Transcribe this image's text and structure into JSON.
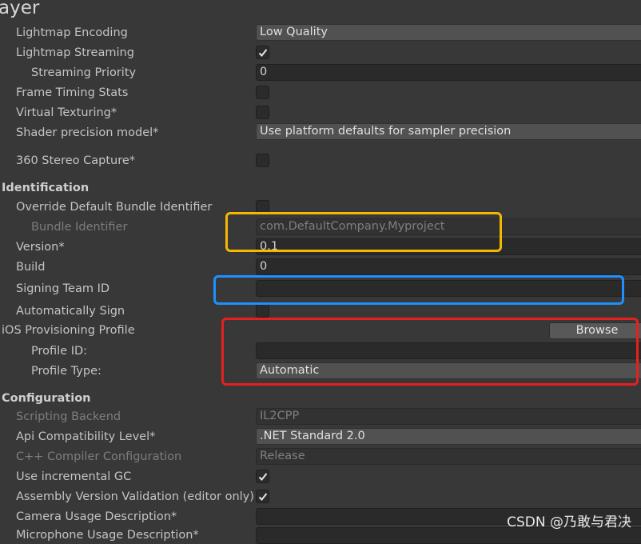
{
  "header": {
    "title": "ayer"
  },
  "rows": {
    "lightmap_encoding": {
      "label": "Lightmap Encoding",
      "value": "Low Quality"
    },
    "lightmap_streaming": {
      "label": "Lightmap Streaming",
      "checked": true
    },
    "streaming_priority": {
      "label": "Streaming Priority",
      "value": "0"
    },
    "frame_timing": {
      "label": "Frame Timing Stats",
      "checked": false
    },
    "virtual_texturing": {
      "label": "Virtual Texturing*",
      "checked": false
    },
    "shader_precision": {
      "label": "Shader precision model*",
      "value": "Use platform defaults for sampler precision"
    },
    "stereo_capture": {
      "label": "360 Stereo Capture*",
      "checked": false
    }
  },
  "identification": {
    "heading": "Identification",
    "override_bundle": {
      "label": "Override Default Bundle Identifier",
      "checked": false
    },
    "bundle_identifier": {
      "label": "Bundle Identifier",
      "value": "com.DefaultCompany.Myproject"
    },
    "version": {
      "label": "Version*",
      "value": "0.1"
    },
    "build": {
      "label": "Build",
      "value": "0"
    },
    "signing_team": {
      "label": "Signing Team ID",
      "value": ""
    },
    "auto_sign": {
      "label": "Automatically Sign",
      "checked": false
    },
    "provisioning": {
      "label": "iOS Provisioning Profile",
      "browse_label": "Browse"
    },
    "profile_id": {
      "label": "Profile ID:",
      "value": ""
    },
    "profile_type": {
      "label": "Profile Type:",
      "value": "Automatic"
    }
  },
  "configuration": {
    "heading": "Configuration",
    "scripting_backend": {
      "label": "Scripting Backend",
      "value": "IL2CPP"
    },
    "api_level": {
      "label": "Api Compatibility Level*",
      "value": ".NET Standard 2.0"
    },
    "cpp_config": {
      "label": "C++ Compiler Configuration",
      "value": "Release"
    },
    "incremental_gc": {
      "label": "Use incremental GC",
      "checked": true
    },
    "assembly_validation": {
      "label": "Assembly Version Validation (editor only)",
      "checked": true
    },
    "camera_usage": {
      "label": "Camera Usage Description*",
      "value": ""
    },
    "microphone_usage": {
      "label": "Microphone Usage Description*",
      "value": ""
    }
  },
  "annotations": {
    "yellow": "#f5b700",
    "blue": "#1e90ff",
    "red": "#e5201e"
  },
  "watermark": "CSDN @乃敢与君决"
}
